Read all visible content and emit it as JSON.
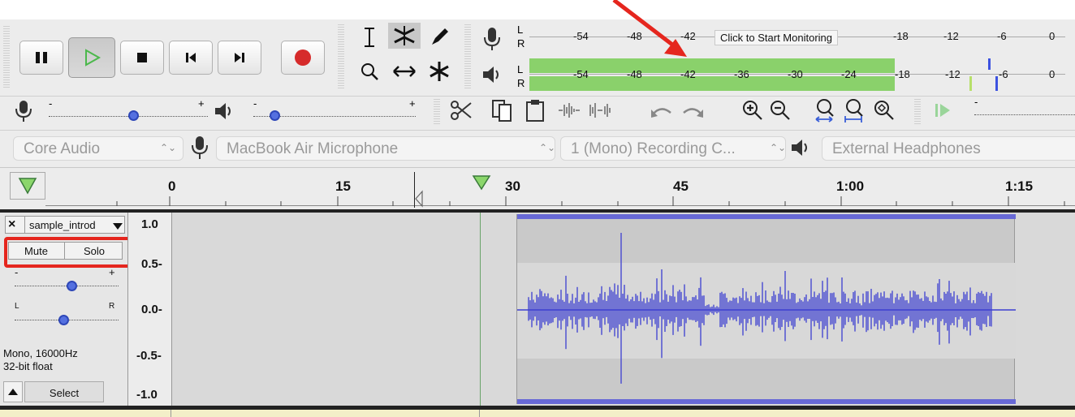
{
  "transport": {
    "pause_icon": "pause-icon",
    "play_icon": "play-icon",
    "stop_icon": "stop-icon",
    "skip_start_icon": "skip-to-start-icon",
    "skip_end_icon": "skip-to-end-icon",
    "record_icon": "record-icon",
    "record_color": "#d62b2b",
    "play_color": "#4cb84c"
  },
  "meters": {
    "record_L": "L",
    "record_R": "R",
    "play_L": "L",
    "play_R": "R",
    "record_ticks": [
      "-54",
      "-48",
      "-42",
      "-18",
      "-12",
      "-6",
      "0"
    ],
    "monitor_tooltip": "Click to Start Monitoring",
    "play_ticks": [
      "-54",
      "-48",
      "-42",
      "-36",
      "-30",
      "-24",
      "-18",
      "-12",
      "-6",
      "0"
    ],
    "bar_color": "#8ad16b"
  },
  "mixer": {
    "rec_minus": "-",
    "rec_plus": "+",
    "play_minus": "-",
    "play_plus": "+"
  },
  "devices": {
    "host": "Core Audio",
    "rec_device": "MacBook Air Microphone",
    "channels": "1 (Mono) Recording C...",
    "play_device": "External Headphones"
  },
  "ruler": {
    "labels": [
      "0",
      "15",
      "30",
      "45",
      "1:00",
      "1:15"
    ]
  },
  "track": {
    "name": "sample_introd",
    "close": "×",
    "mute": "Mute",
    "solo": "Solo",
    "gain_minus": "-",
    "gain_plus": "+",
    "pan_left": "L",
    "pan_right": "R",
    "format_line1": "Mono, 16000Hz",
    "format_line2": "32-bit float",
    "select": "Select",
    "y_axis": [
      "1.0",
      "0.5-",
      "0.0-",
      "-0.5-",
      "-1.0"
    ],
    "highlight_color": "#e5261e",
    "waveform_color": "#3c3fd1"
  },
  "annotation": {
    "arrow_color": "#e5261e"
  }
}
